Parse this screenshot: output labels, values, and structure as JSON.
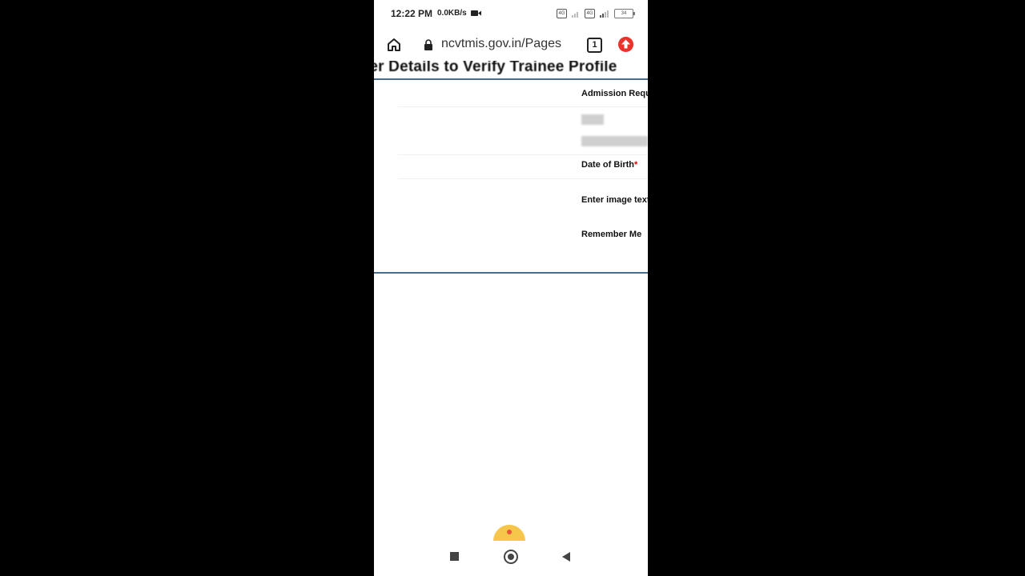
{
  "status_bar": {
    "time": "12:22 PM",
    "speed": "0.0KB/s",
    "sim1": "4G",
    "sim2": "4G",
    "battery": "34"
  },
  "browser": {
    "url": "ncvtmis.gov.in/Pages",
    "tab_count": "1"
  },
  "page": {
    "heading": "nter Details to Verify Trainee Profile",
    "labels": {
      "admission": "Admission Requ",
      "dob": "Date of Birth",
      "dob_required": "*",
      "captcha": "Enter image text",
      "remember": "Remember Me"
    }
  },
  "icons": {
    "home": "home-icon",
    "lock": "lock-icon",
    "tabs": "tabs-icon",
    "update": "update-arrow-icon",
    "camera": "video-camera-icon"
  },
  "colors": {
    "panel_border": "#4a6d8c",
    "required": "#dd0000",
    "update_red": "#e8322a"
  }
}
